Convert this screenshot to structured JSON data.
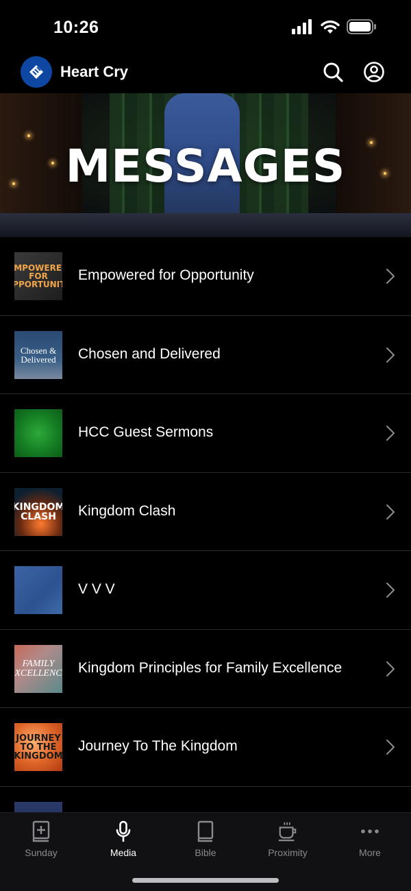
{
  "status": {
    "time": "10:26"
  },
  "header": {
    "title": "Heart Cry"
  },
  "hero": {
    "title": "MESSAGES"
  },
  "messages": [
    {
      "title": "Empowered for Opportunity",
      "thumb_text": "EMPOWERED FOR OPPORTUNITY"
    },
    {
      "title": "Chosen and Delivered",
      "thumb_text": "Chosen & Delivered"
    },
    {
      "title": "HCC Guest Sermons",
      "thumb_text": ""
    },
    {
      "title": "Kingdom Clash",
      "thumb_text": "KINGDOM CLASH"
    },
    {
      "title": "V V V",
      "thumb_text": ""
    },
    {
      "title": "Kingdom Principles for Family Excellence",
      "thumb_text": "FAMILY EXCELLENCE"
    },
    {
      "title": "Journey To The Kingdom",
      "thumb_text": "JOURNEY TO THE KINGDOM"
    }
  ],
  "tabs": [
    {
      "label": "Sunday",
      "icon": "bible-plus-icon",
      "active": false
    },
    {
      "label": "Media",
      "icon": "microphone-icon",
      "active": true
    },
    {
      "label": "Bible",
      "icon": "book-icon",
      "active": false
    },
    {
      "label": "Proximity",
      "icon": "coffee-cup-icon",
      "active": false
    },
    {
      "label": "More",
      "icon": "more-dots-icon",
      "active": false
    }
  ],
  "colors": {
    "background": "#000000",
    "logo": "#0d47a1",
    "tab_inactive": "#8a8a90",
    "divider": "#2a2a2e"
  }
}
